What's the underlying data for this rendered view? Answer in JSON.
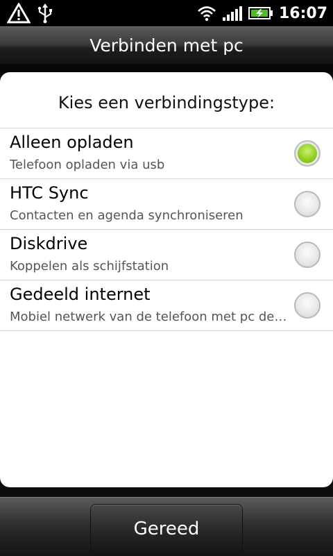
{
  "status_bar": {
    "time": "16:07",
    "icons": [
      "warning-icon",
      "usb-icon",
      "wifi-icon",
      "signal-icon",
      "battery-charging-icon"
    ]
  },
  "title_bar": {
    "title": "Verbinden met pc"
  },
  "dialog": {
    "prompt": "Kies een verbindingstype:",
    "options": [
      {
        "label": "Alleen opladen",
        "description": "Telefoon opladen via usb",
        "selected": true
      },
      {
        "label": "HTC Sync",
        "description": "Contacten en agenda synchroniseren",
        "selected": false
      },
      {
        "label": "Diskdrive",
        "description": "Koppelen als schijfstation",
        "selected": false
      },
      {
        "label": "Gedeeld internet",
        "description": "Mobiel netwerk van de telefoon met pc de…",
        "selected": false
      }
    ]
  },
  "footer": {
    "done_label": "Gereed"
  },
  "colors": {
    "selected_radio": "#8fcf1e",
    "background": "#000000"
  }
}
